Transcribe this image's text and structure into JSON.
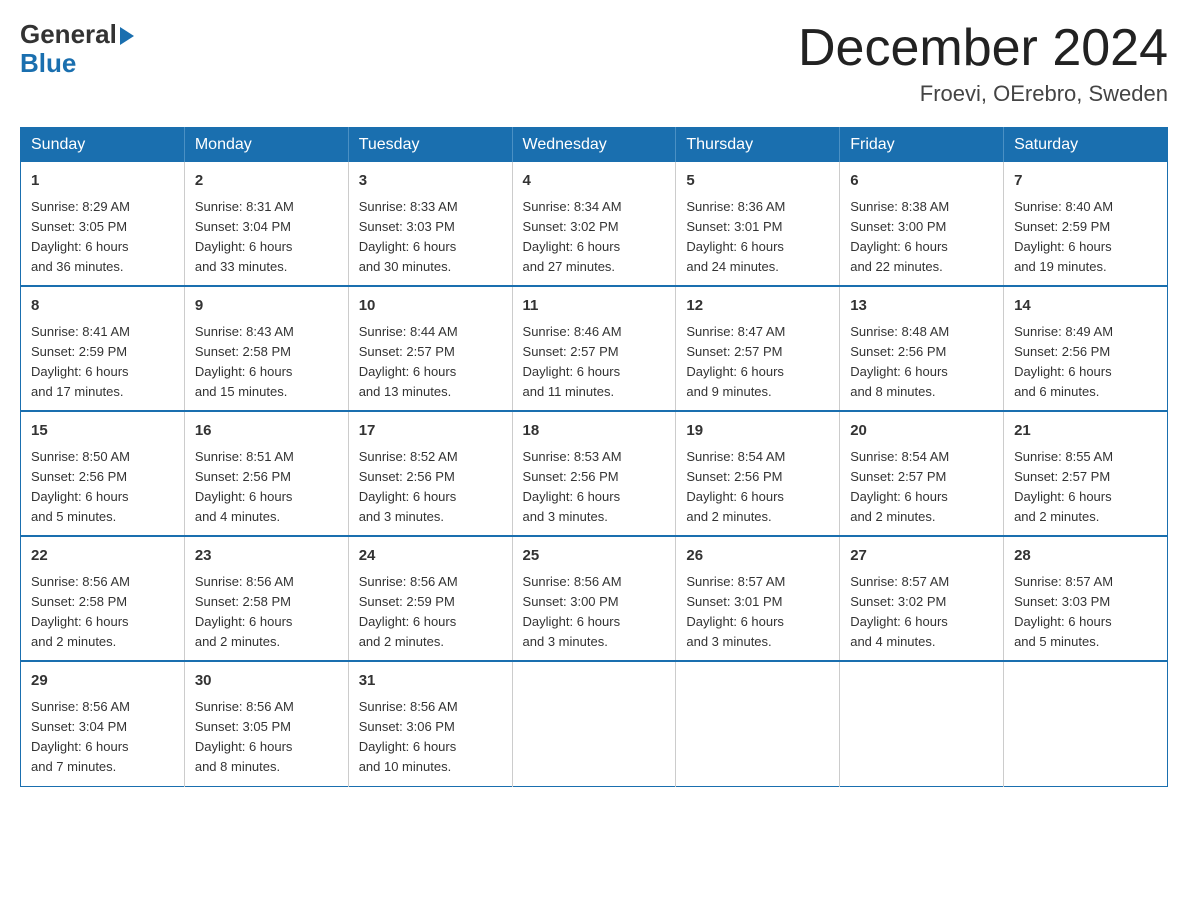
{
  "header": {
    "logo": {
      "general": "General",
      "blue": "Blue",
      "arrow": "▶"
    },
    "title": "December 2024",
    "location": "Froevi, OErebro, Sweden"
  },
  "calendar": {
    "days_of_week": [
      "Sunday",
      "Monday",
      "Tuesday",
      "Wednesday",
      "Thursday",
      "Friday",
      "Saturday"
    ],
    "weeks": [
      [
        {
          "day": "1",
          "sunrise": "8:29 AM",
          "sunset": "3:05 PM",
          "daylight": "6 hours and 36 minutes."
        },
        {
          "day": "2",
          "sunrise": "8:31 AM",
          "sunset": "3:04 PM",
          "daylight": "6 hours and 33 minutes."
        },
        {
          "day": "3",
          "sunrise": "8:33 AM",
          "sunset": "3:03 PM",
          "daylight": "6 hours and 30 minutes."
        },
        {
          "day": "4",
          "sunrise": "8:34 AM",
          "sunset": "3:02 PM",
          "daylight": "6 hours and 27 minutes."
        },
        {
          "day": "5",
          "sunrise": "8:36 AM",
          "sunset": "3:01 PM",
          "daylight": "6 hours and 24 minutes."
        },
        {
          "day": "6",
          "sunrise": "8:38 AM",
          "sunset": "3:00 PM",
          "daylight": "6 hours and 22 minutes."
        },
        {
          "day": "7",
          "sunrise": "8:40 AM",
          "sunset": "2:59 PM",
          "daylight": "6 hours and 19 minutes."
        }
      ],
      [
        {
          "day": "8",
          "sunrise": "8:41 AM",
          "sunset": "2:59 PM",
          "daylight": "6 hours and 17 minutes."
        },
        {
          "day": "9",
          "sunrise": "8:43 AM",
          "sunset": "2:58 PM",
          "daylight": "6 hours and 15 minutes."
        },
        {
          "day": "10",
          "sunrise": "8:44 AM",
          "sunset": "2:57 PM",
          "daylight": "6 hours and 13 minutes."
        },
        {
          "day": "11",
          "sunrise": "8:46 AM",
          "sunset": "2:57 PM",
          "daylight": "6 hours and 11 minutes."
        },
        {
          "day": "12",
          "sunrise": "8:47 AM",
          "sunset": "2:57 PM",
          "daylight": "6 hours and 9 minutes."
        },
        {
          "day": "13",
          "sunrise": "8:48 AM",
          "sunset": "2:56 PM",
          "daylight": "6 hours and 8 minutes."
        },
        {
          "day": "14",
          "sunrise": "8:49 AM",
          "sunset": "2:56 PM",
          "daylight": "6 hours and 6 minutes."
        }
      ],
      [
        {
          "day": "15",
          "sunrise": "8:50 AM",
          "sunset": "2:56 PM",
          "daylight": "6 hours and 5 minutes."
        },
        {
          "day": "16",
          "sunrise": "8:51 AM",
          "sunset": "2:56 PM",
          "daylight": "6 hours and 4 minutes."
        },
        {
          "day": "17",
          "sunrise": "8:52 AM",
          "sunset": "2:56 PM",
          "daylight": "6 hours and 3 minutes."
        },
        {
          "day": "18",
          "sunrise": "8:53 AM",
          "sunset": "2:56 PM",
          "daylight": "6 hours and 3 minutes."
        },
        {
          "day": "19",
          "sunrise": "8:54 AM",
          "sunset": "2:56 PM",
          "daylight": "6 hours and 2 minutes."
        },
        {
          "day": "20",
          "sunrise": "8:54 AM",
          "sunset": "2:57 PM",
          "daylight": "6 hours and 2 minutes."
        },
        {
          "day": "21",
          "sunrise": "8:55 AM",
          "sunset": "2:57 PM",
          "daylight": "6 hours and 2 minutes."
        }
      ],
      [
        {
          "day": "22",
          "sunrise": "8:56 AM",
          "sunset": "2:58 PM",
          "daylight": "6 hours and 2 minutes."
        },
        {
          "day": "23",
          "sunrise": "8:56 AM",
          "sunset": "2:58 PM",
          "daylight": "6 hours and 2 minutes."
        },
        {
          "day": "24",
          "sunrise": "8:56 AM",
          "sunset": "2:59 PM",
          "daylight": "6 hours and 2 minutes."
        },
        {
          "day": "25",
          "sunrise": "8:56 AM",
          "sunset": "3:00 PM",
          "daylight": "6 hours and 3 minutes."
        },
        {
          "day": "26",
          "sunrise": "8:57 AM",
          "sunset": "3:01 PM",
          "daylight": "6 hours and 3 minutes."
        },
        {
          "day": "27",
          "sunrise": "8:57 AM",
          "sunset": "3:02 PM",
          "daylight": "6 hours and 4 minutes."
        },
        {
          "day": "28",
          "sunrise": "8:57 AM",
          "sunset": "3:03 PM",
          "daylight": "6 hours and 5 minutes."
        }
      ],
      [
        {
          "day": "29",
          "sunrise": "8:56 AM",
          "sunset": "3:04 PM",
          "daylight": "6 hours and 7 minutes."
        },
        {
          "day": "30",
          "sunrise": "8:56 AM",
          "sunset": "3:05 PM",
          "daylight": "6 hours and 8 minutes."
        },
        {
          "day": "31",
          "sunrise": "8:56 AM",
          "sunset": "3:06 PM",
          "daylight": "6 hours and 10 minutes."
        },
        null,
        null,
        null,
        null
      ]
    ],
    "labels": {
      "sunrise": "Sunrise:",
      "sunset": "Sunset:",
      "daylight": "Daylight:"
    }
  }
}
